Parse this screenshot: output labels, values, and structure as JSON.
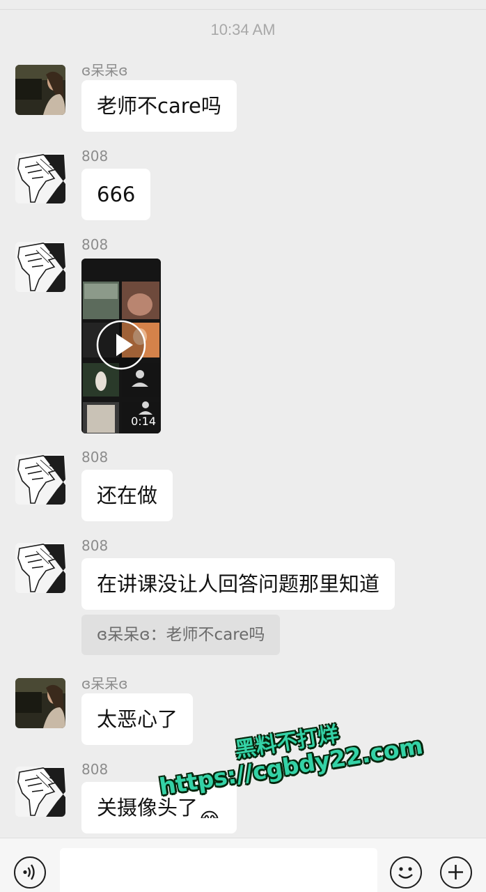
{
  "timestamp": "10:34 AM",
  "messages": [
    {
      "sender": "ɞ呆呆ɞ",
      "text": "老师不care吗"
    },
    {
      "sender": "808",
      "text": "666"
    },
    {
      "sender": "808",
      "video_duration": "0:14"
    },
    {
      "sender": "808",
      "text": "还在做"
    },
    {
      "sender": "808",
      "text": "在讲课没让人回答问题那里知道",
      "quote": "ɞ呆呆ɞ：老师不care吗"
    },
    {
      "sender": "ɞ呆呆ɞ",
      "text": "太恶心了"
    },
    {
      "sender": "808",
      "text": "关摄像头了",
      "emoji": "😂"
    }
  ],
  "input": {
    "placeholder": ""
  },
  "icons": {
    "voice": "voice-icon",
    "emoji": "emoji-icon",
    "more": "plus-icon"
  },
  "watermark": {
    "line1": "黑料不打烊",
    "line2": "https://cgbdy22.com"
  },
  "colors": {
    "background": "#ededed",
    "bubble": "#ffffff",
    "watermark": "#34d2a6"
  }
}
